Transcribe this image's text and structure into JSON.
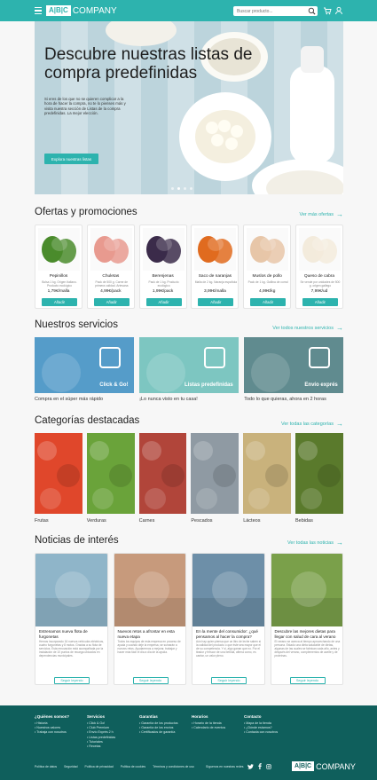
{
  "header": {
    "brand_mark": "A|B|C",
    "brand_name": "COMPANY",
    "search_placeholder": "Buscar producto..."
  },
  "hero": {
    "title": "Descubre nuestras listas de compra predefinidas",
    "text": "Si eres de los que no se quieren complicar a la hora de hacer la compra, no te lo pienses más y visita nuestra sección de Listas de la compra predefinidas. La mejor elección.",
    "cta": "Explora nuestras listas",
    "slides": 4,
    "active_slide": 1
  },
  "offers": {
    "title": "Ofertas y promociones",
    "link": "Ver más ofertas",
    "add_label": "Añadir",
    "items": [
      {
        "name": "Pepinillos",
        "desc": "Bolsa 1 kg. Origen Italiano. Producto ecológico",
        "price": "1,79€/malla",
        "color": "#4a8b2c"
      },
      {
        "name": "Chuletas",
        "desc": "Pack de 500 g. Carne de primera calidad. Artesana",
        "price": "4,99€/pack",
        "color": "#e89a8f"
      },
      {
        "name": "Berenjenas",
        "desc": "Pack de 1 kg. Producto ecológico",
        "price": "1,99€/pack",
        "color": "#3b2b4a"
      },
      {
        "name": "Saco de naranjas",
        "desc": "Malla de 2 kg. Naranja española",
        "price": "3,99€/malla",
        "color": "#e06b1f"
      },
      {
        "name": "Muslos de pollo",
        "desc": "Pack de 1 kg. Gallina de corral",
        "price": "4,99€/kg",
        "color": "#e7c6a8"
      },
      {
        "name": "Queso de cabra",
        "desc": "Se vende por unidades de 500 g. origen gallego",
        "price": "7,99€/ud",
        "color": "#f3ebdc"
      }
    ]
  },
  "services": {
    "title": "Nuestros servicios",
    "link": "Ver todos nuestros servicios",
    "items": [
      {
        "label": "Click & Go!",
        "caption": "Compra en el súper más rápido",
        "color": "#3e8fc2"
      },
      {
        "label": "Listas predefinidas",
        "caption": "¡Lo nunca visto en tu casa!",
        "color": "#6bbfb9"
      },
      {
        "label": "Envío exprés",
        "caption": "Todo lo que quieras, ahora en 2 horas",
        "color": "#4a7b80"
      }
    ]
  },
  "categories": {
    "title": "Categorías destacadas",
    "link": "Ver todas las categorías",
    "items": [
      {
        "name": "Frutas",
        "color": "#e0472b"
      },
      {
        "name": "Verduras",
        "color": "#6aa33a"
      },
      {
        "name": "Carnes",
        "color": "#b1453a"
      },
      {
        "name": "Pescados",
        "color": "#8f9aa3"
      },
      {
        "name": "Lácteos",
        "color": "#c9b27c"
      },
      {
        "name": "Bebidas",
        "color": "#5a7a2c"
      }
    ]
  },
  "news": {
    "title": "Noticias de interés",
    "link": "Ver todas las noticias",
    "button": "Seguir leyendo",
    "items": [
      {
        "title": "Estrenamos nueva flota de furgonetas",
        "text": "Hemos incorporado 16 nuevos vehículos eléctricos, cuatro furgonetas y 8 motos. Gracias a su flota de servicios. Esta renovación está acompañada por la instalación de 10 puntos de recarga ubicados en dependencias municipales.",
        "color": "#8fb5c9"
      },
      {
        "title": "Nuevos retos a afrontar en esta nueva etapa",
        "text": "Todos los equipos de esta empresa en proceso de ayuda y cuando deje la empresa, se sumarán a nuevos retos. Ayudaremos a mejorar, trabajar y hacer más fácil el día a día de la ayuda.",
        "color": "#c79a7c"
      },
      {
        "title": "En la mente del consumidor: ¿qué pensamos al hacer la compra?",
        "text": "Aún hay quien piensa que un litro de leche saben si la calidad del producto o que éste sea mayor que el de su competencia. Y si, algo ganan que no. Por el tirador y frescor de una bebida, afirma como, es cantar, un valor pleno.",
        "color": "#6d8fa8"
      },
      {
        "title": "Descubre las mejores dietas para llegar con salud de cara al verano",
        "text": "El verano se acerca al tiempo aprovechando de una persona. Estado una dieta saludable de dietas, algunas de las cuales se fabrican cada año, antes y después del verano, complementos de aceite y de proteínas.",
        "color": "#7aa04a"
      }
    ]
  },
  "footer": {
    "columns": [
      {
        "title": "¿Quiénes somos?",
        "items": [
          "Historia",
          "Nuestros valores",
          "Trabaja con nosotros"
        ]
      },
      {
        "title": "Servicios",
        "items": [
          "Click & Go!",
          "Club Premium",
          "Envío Exprés 2 h",
          "Listas predefinidas",
          "Tutoriales",
          "Recetas"
        ]
      },
      {
        "title": "Garantías",
        "items": [
          "Garantía de los productos",
          "Garantía de los envíos",
          "Certificados de garantía"
        ]
      },
      {
        "title": "Horarios",
        "items": [
          "Horario de la tienda",
          "Calendario de eventos"
        ]
      },
      {
        "title": "Contacto",
        "items": [
          "Mapa de la tienda",
          "¿Dónde estamos?",
          "Contacta con nosotros"
        ]
      }
    ],
    "legal": [
      "Política de datos",
      "Seguridad",
      "Política de privacidad",
      "Política de cookies",
      "Términos y condiciones de uso"
    ],
    "social_label": "Síguenos en nuestras redes"
  }
}
